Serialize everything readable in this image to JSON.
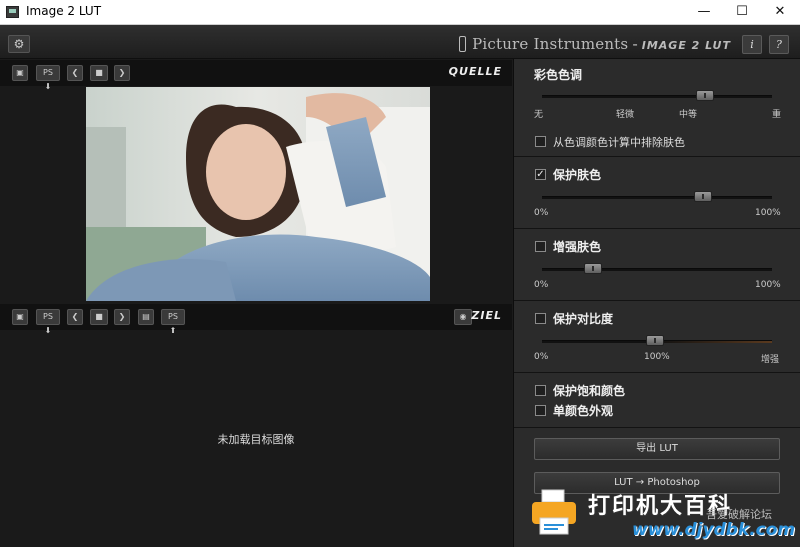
{
  "window": {
    "title": "Image 2 LUT",
    "minimize": "—",
    "maximize": "☐",
    "close": "✕"
  },
  "toolbar": {
    "settings_icon": "gear-icon",
    "brand": "Picture Instruments",
    "brand_sep": "-",
    "product": "IMAGE 2 LUT",
    "info_label": "i",
    "help_label": "?"
  },
  "source": {
    "label": "QUELLE",
    "ps_label": "PS ⬇",
    "prev": "❮",
    "next": "❯"
  },
  "target": {
    "label": "ZIEL",
    "ps_in_label": "PS ⬇",
    "ps_out_label": "PS ⬆",
    "prev": "❮",
    "next": "❯",
    "empty_message": "未加载目标图像"
  },
  "color_tone": {
    "heading": "彩色色调",
    "ticks": [
      "无",
      "轻微",
      "中等",
      "重"
    ],
    "level": 0.71,
    "exclude_skin_label": "从色调颜色计算中排除肤色",
    "exclude_skin_checked": false
  },
  "protect_skin": {
    "label": "保护肤色",
    "checked": true,
    "check_mark": "✓",
    "min": "0%",
    "max": "100%",
    "level": 0.7
  },
  "enhance_skin": {
    "label": "增强肤色",
    "checked": false,
    "min": "0%",
    "max": "100%",
    "level": 0.22
  },
  "protect_contrast": {
    "label": "保护对比度",
    "checked": false,
    "min": "0%",
    "mid": "100%",
    "max": "增强",
    "level": 0.49
  },
  "options": {
    "protect_saturation_label": "保护饱和颜色",
    "protect_saturation_checked": false,
    "mono_label": "单颜色外观",
    "mono_checked": false
  },
  "actions": {
    "export_lut": "导出 LUT",
    "lut_photoshop": "LUT → Photoshop"
  },
  "watermark": {
    "brand": "打印机大百科",
    "url": "www.djydbk.com",
    "forum": "吾爱破解论坛"
  }
}
